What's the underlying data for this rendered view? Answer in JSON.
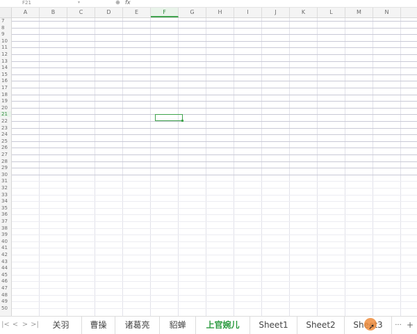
{
  "formula_bar": {
    "name_box_value": "F21",
    "zoom_icon": "magnifier-icon",
    "fx_label": "fx"
  },
  "columns": [
    "A",
    "B",
    "C",
    "D",
    "E",
    "F",
    "G",
    "H",
    "I",
    "J",
    "K",
    "L",
    "M",
    "N"
  ],
  "active_column": "F",
  "rows": [
    "7",
    "8",
    "9",
    "10",
    "11",
    "12",
    "13",
    "14",
    "15",
    "16",
    "17",
    "18",
    "19",
    "20",
    "21",
    "22",
    "23",
    "24",
    "25",
    "26",
    "27",
    "28",
    "29",
    "30",
    "31",
    "32",
    "33",
    "34",
    "35",
    "36",
    "37",
    "38",
    "39",
    "40",
    "41",
    "42",
    "43",
    "44",
    "45",
    "46",
    "47",
    "48",
    "49",
    "50"
  ],
  "active_row": "21",
  "tabs": [
    {
      "label": "关羽",
      "active": false
    },
    {
      "label": "曹操",
      "active": false
    },
    {
      "label": "诸葛亮",
      "active": false
    },
    {
      "label": "貂蝉",
      "active": false
    },
    {
      "label": "上官婉儿",
      "active": true
    },
    {
      "label": "Sheet1",
      "active": false
    },
    {
      "label": "Sheet2",
      "active": false
    },
    {
      "label": "Sheet3",
      "active": false
    }
  ],
  "tab_nav": {
    "first": "|<",
    "prev": "<",
    "next": ">",
    "last": ">|"
  },
  "more_label": "···",
  "add_label": "+",
  "colors": {
    "accent": "#3fa34d",
    "active_tab": "#2b9a3f",
    "cursor": "#ee8c3c"
  }
}
